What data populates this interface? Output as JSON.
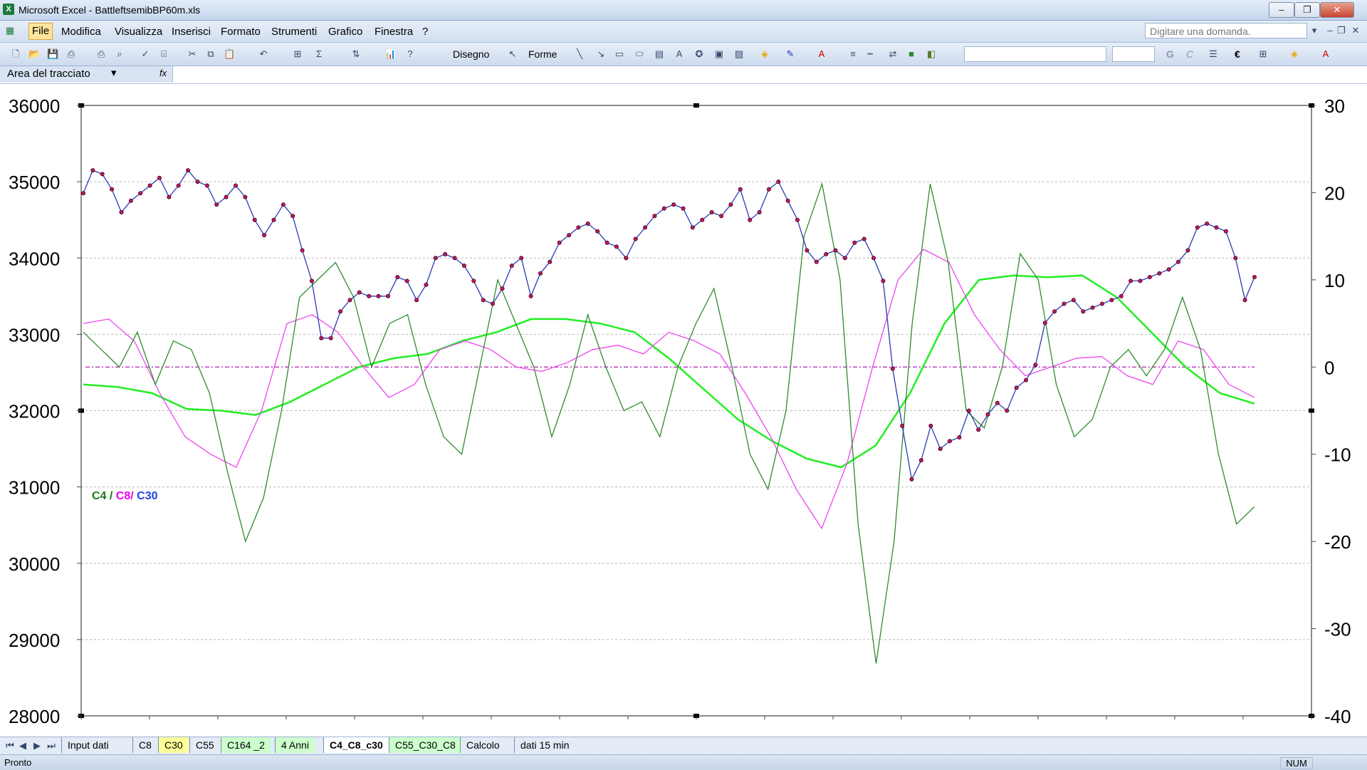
{
  "window": {
    "title": "Microsoft Excel - BattleftsemibBP60m.xls",
    "buttons": {
      "minimize": "‒",
      "restore": "❐",
      "close": "✕"
    }
  },
  "menu": {
    "items": [
      "File",
      "Modifica",
      "Visualizza",
      "Inserisci",
      "Formato",
      "Strumenti",
      "Grafico",
      "Finestra",
      "?"
    ],
    "help_placeholder": "Digitare una domanda."
  },
  "toolbar": {
    "draw_label": "Disegno",
    "shapes_label": "Forme",
    "bold": "G",
    "italic": "C",
    "euro": "€"
  },
  "namebox": {
    "value": "Area del tracciato",
    "fx": "fx"
  },
  "chart_data": {
    "type": "line",
    "left_axis": {
      "range": [
        28000,
        36000
      ],
      "ticks": [
        "36000",
        "35000",
        "34000",
        "33000",
        "32000",
        "31000",
        "30000",
        "29000",
        "28000"
      ]
    },
    "right_axis": {
      "range": [
        -40,
        30
      ],
      "ticks": [
        "30",
        "20",
        "10",
        "0",
        "-10",
        "-20",
        "-30",
        "-40"
      ]
    },
    "grid": "horizontal dashed",
    "legend": {
      "parts": [
        "C4",
        " / ",
        "C8",
        "/ ",
        "C30"
      ],
      "colors": [
        "#1a7a1a",
        "#1a7a1a",
        "#ee00ee",
        "#ee00ee",
        "#2244dd"
      ]
    },
    "series": [
      {
        "axis": "left",
        "color": "#2b3bb3",
        "marker_color": "#c2185b",
        "y": [
          34850,
          35150,
          35100,
          34900,
          34600,
          34750,
          34850,
          34950,
          35050,
          34800,
          34950,
          35150,
          35000,
          34950,
          34700,
          34800,
          34950,
          34800,
          34500,
          34300,
          34500,
          34700,
          34550,
          34100,
          33700,
          32950,
          32950,
          33300,
          33450,
          33550,
          33500,
          33500,
          33500,
          33750,
          33700,
          33450,
          33650,
          34000,
          34050,
          34000,
          33900,
          33700,
          33450,
          33400,
          33600,
          33900,
          34000,
          33500,
          33800,
          33950,
          34200,
          34300,
          34400,
          34450,
          34350,
          34200,
          34150,
          34000,
          34250,
          34400,
          34550,
          34650,
          34700,
          34650,
          34400,
          34500,
          34600,
          34550,
          34700,
          34900,
          34500,
          34600,
          34900,
          35000,
          34750,
          34500,
          34100,
          33950,
          34050,
          34100,
          34000,
          34200,
          34250,
          34000,
          33700,
          32550,
          31800,
          31100,
          31350,
          31800,
          31500,
          31600,
          31650,
          32000,
          31750,
          31950,
          32100,
          32000,
          32300,
          32400,
          32600,
          33150,
          33300,
          33400,
          33450,
          33300,
          33350,
          33400,
          33450,
          33500,
          33700,
          33700,
          33750,
          33800,
          33850,
          33950,
          34100,
          34400,
          34450,
          34400,
          34350,
          34000,
          33450,
          33750
        ]
      },
      {
        "axis": "right",
        "color": "#2e8b2e",
        "y": [
          4,
          2,
          0,
          4,
          -2,
          3,
          2,
          -3,
          -12,
          -20,
          -15,
          -5,
          8,
          10,
          12,
          8,
          0,
          5,
          6,
          -2,
          -8,
          -10,
          0,
          10,
          5,
          0,
          -8,
          -2,
          6,
          0,
          -5,
          -4,
          -8,
          0,
          5,
          9,
          0,
          -10,
          -14,
          -5,
          15,
          21,
          10,
          -18,
          -34,
          -20,
          5,
          21,
          12,
          -5,
          -7,
          0,
          13,
          10,
          -2,
          -8,
          -6,
          0,
          2,
          -1,
          2,
          8,
          2,
          -10,
          -18,
          -16
        ]
      },
      {
        "axis": "right",
        "color": "#ee44ee",
        "y": [
          5,
          5.5,
          3,
          -3,
          -8,
          -10,
          -11.5,
          -5,
          5,
          6,
          4,
          0,
          -3.5,
          -2,
          2,
          3,
          2,
          0,
          -0.5,
          0.5,
          2,
          2.5,
          1.5,
          4,
          3,
          1.5,
          -3,
          -8,
          -14,
          -18.5,
          -11,
          0,
          10,
          13.5,
          12,
          6,
          2,
          -1,
          0,
          1,
          1.2,
          -1,
          -2,
          3,
          2,
          -2,
          -3.5
        ]
      },
      {
        "axis": "right",
        "color": "#22ee22",
        "y": [
          -2,
          -2.3,
          -3,
          -4.8,
          -5,
          -5.5,
          -4,
          -2,
          0,
          1,
          1.5,
          3,
          4,
          5.5,
          5.5,
          5,
          4,
          1,
          -2.5,
          -6,
          -8.5,
          -10.5,
          -11.5,
          -9,
          -3,
          5,
          10,
          10.5,
          10.3,
          10.5,
          8,
          4,
          0,
          -3,
          -4.2
        ]
      },
      {
        "axis": "right",
        "color": "#bb33bb",
        "dashed": true,
        "y": [
          0,
          0
        ]
      }
    ]
  },
  "sheet_tabs": [
    "Input dati",
    "C8",
    "C30",
    "C55",
    "C164 _2",
    "4 Anni",
    "C4_C8_c30",
    "C55_C30_C8",
    "Calcolo",
    "dati 15 min"
  ],
  "active_tab": "C4_C8_c30",
  "tab_colors": {
    "C30": "#ffff99",
    "C164 _2": "#ccffcc",
    "4 Anni": "#ccffcc",
    "C55_C30_C8": "#ccffcc"
  },
  "status": {
    "left": "Pronto",
    "num": "NUM"
  }
}
